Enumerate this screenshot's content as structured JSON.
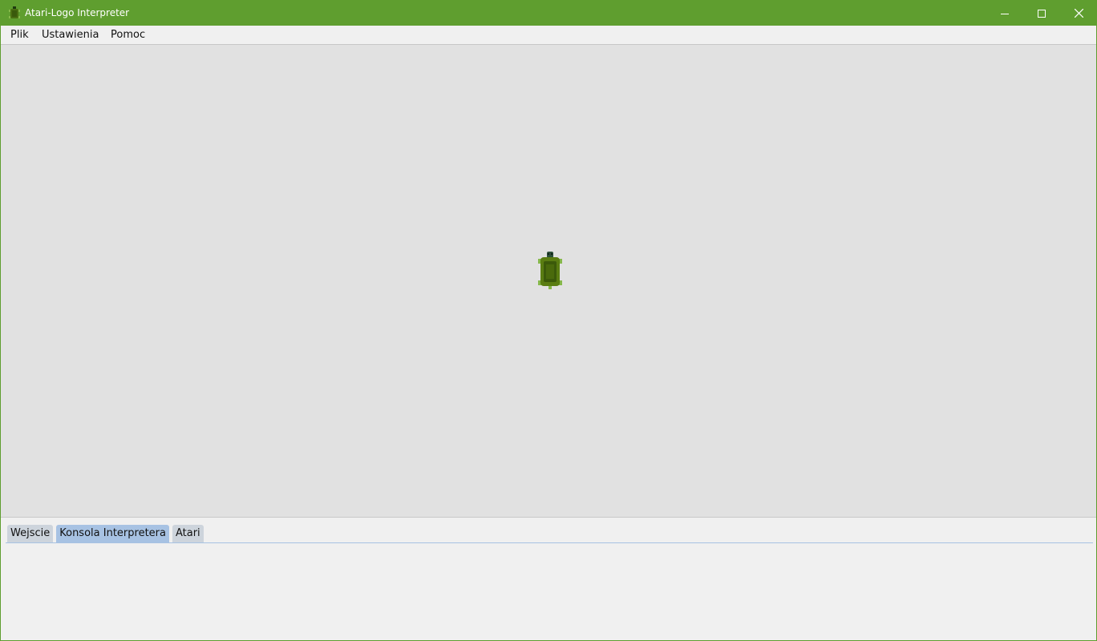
{
  "window": {
    "title": "Atari-Logo Interpreter",
    "accent_color": "#5f9e2f",
    "controls": {
      "minimize_icon": "minimize-icon",
      "maximize_icon": "maximize-icon",
      "close_icon": "close-icon"
    }
  },
  "menubar": {
    "items": [
      {
        "label": "Plik"
      },
      {
        "label": "Ustawienia"
      },
      {
        "label": "Pomoc"
      }
    ]
  },
  "canvas": {
    "background": "#e1e1e1",
    "turtle_icon": "turtle-icon",
    "turtle_heading": "up"
  },
  "bottom_panel": {
    "tabs": [
      {
        "label": "Wejscie",
        "active": false
      },
      {
        "label": "Konsola Interpretera",
        "active": true
      },
      {
        "label": "Atari",
        "active": false
      }
    ]
  }
}
